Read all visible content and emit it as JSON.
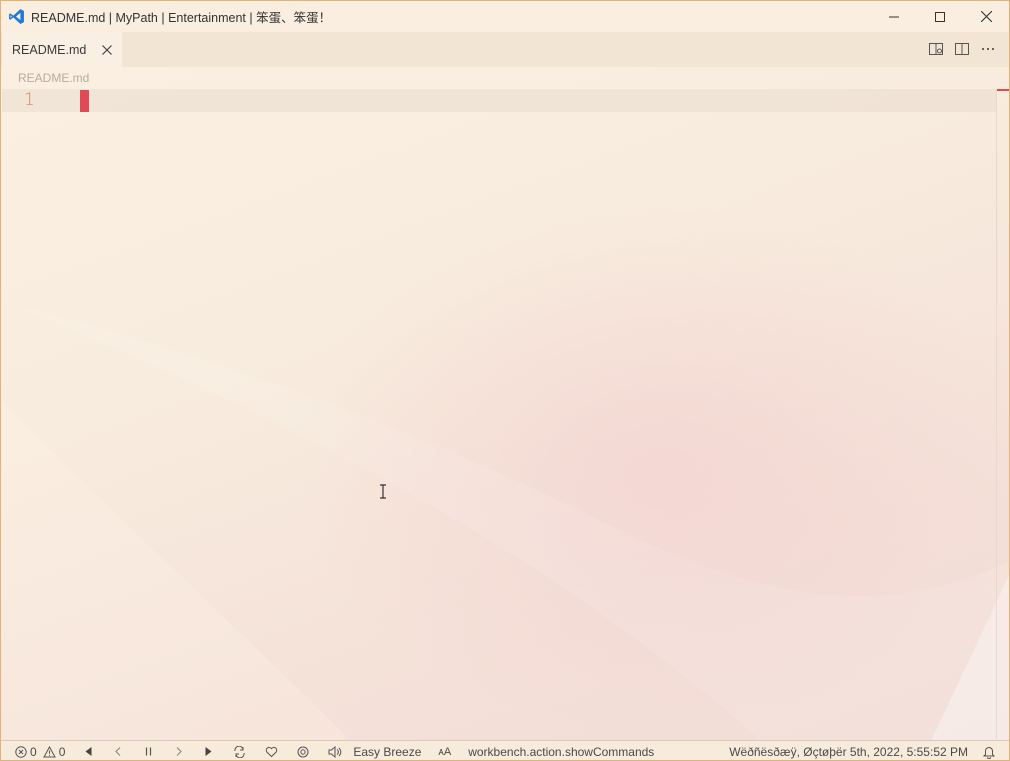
{
  "window": {
    "title": "README.md | MyPath | Entertainment | 笨蛋、笨蛋！"
  },
  "tabs": [
    {
      "label": "README.md",
      "active": true
    }
  ],
  "breadcrumb": {
    "file": "README.md"
  },
  "editor": {
    "line_numbers": [
      "1"
    ],
    "content": ""
  },
  "statusbar": {
    "errors": "0",
    "warnings": "0",
    "theme": "Easy Breeze",
    "font_size_glyph": "ᴀA",
    "command": "workbench.action.showCommands",
    "datetime": "Wëðñësðæÿ, Øçtøþër 5th, 2022, 5:55:52 PM"
  },
  "colors": {
    "accent": "#e04a57",
    "line_number": "#d9825c",
    "vscode_blue": "#1f7ad6",
    "background": "#f8eddf"
  }
}
